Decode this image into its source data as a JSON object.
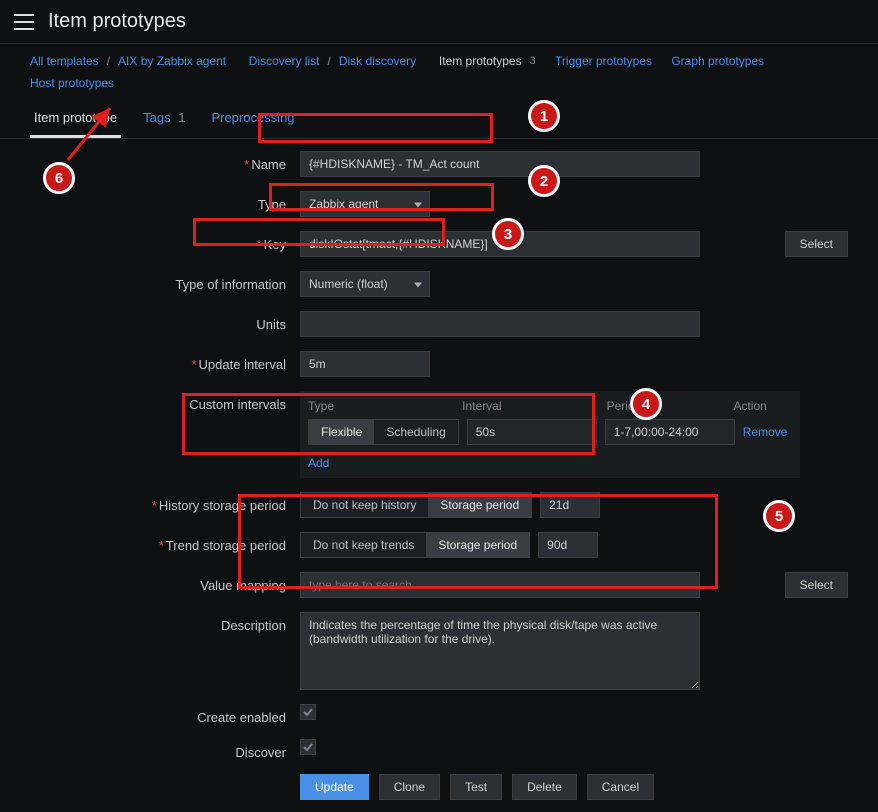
{
  "page_title": "Item prototypes",
  "breadcrumb": {
    "all_templates": "All templates",
    "template": "AIX by Zabbix agent",
    "discovery_list": "Discovery list",
    "discovery_rule": "Disk discovery",
    "item_prototypes": "Item prototypes",
    "item_prototypes_count": "3",
    "trigger_prototypes": "Trigger prototypes",
    "graph_prototypes": "Graph prototypes",
    "host_prototypes": "Host prototypes"
  },
  "tabs": {
    "item_prototype": "Item prototype",
    "tags": "Tags",
    "tags_count": "1",
    "preprocessing": "Preprocessing"
  },
  "labels": {
    "name": "Name",
    "type": "Type",
    "key": "Key",
    "type_of_info": "Type of information",
    "units": "Units",
    "update_interval": "Update interval",
    "custom_intervals": "Custom intervals",
    "history": "History storage period",
    "trend": "Trend storage period",
    "value_mapping": "Value mapping",
    "description": "Description",
    "create_enabled": "Create enabled",
    "discover": "Discover"
  },
  "fields": {
    "name": "{#HDISKNAME} - TM_Act count",
    "type": "Zabbix agent",
    "key": "diskIOstat[tmact,{#HDISKNAME}]",
    "type_of_info": "Numeric (float)",
    "units": "",
    "update_interval": "5m",
    "value_mapping_placeholder": "type here to search",
    "description": "Indicates the percentage of time the physical disk/tape was active (bandwidth utilization for the drive)."
  },
  "intervals": {
    "head_type": "Type",
    "head_interval": "Interval",
    "head_period": "Period",
    "head_action": "Action",
    "flexible": "Flexible",
    "scheduling": "Scheduling",
    "interval_val": "50s",
    "period_val": "1-7,00:00-24:00",
    "remove": "Remove",
    "add": "Add"
  },
  "history": {
    "no_keep": "Do not keep history",
    "storage": "Storage period",
    "value": "21d"
  },
  "trend": {
    "no_keep": "Do not keep trends",
    "storage": "Storage period",
    "value": "90d"
  },
  "buttons": {
    "select": "Select",
    "update": "Update",
    "clone": "Clone",
    "test": "Test",
    "delete": "Delete",
    "cancel": "Cancel"
  },
  "callouts": {
    "c1": "1",
    "c2": "2",
    "c3": "3",
    "c4": "4",
    "c5": "5",
    "c6": "6"
  }
}
